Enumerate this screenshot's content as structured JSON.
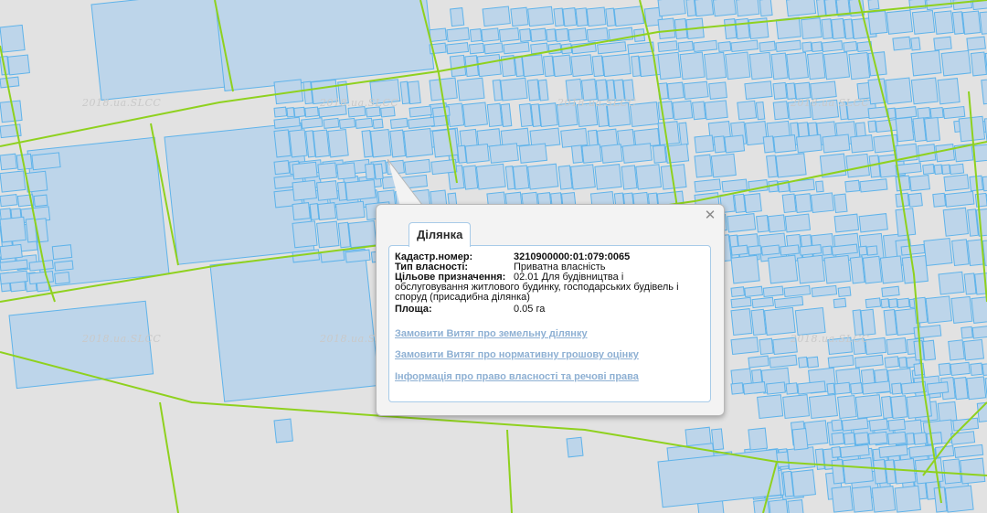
{
  "map": {
    "watermark_text": "2018.ua.SLCC",
    "colors": {
      "background": "#e2e2e2",
      "parcel_fill": "#bdd5ea",
      "parcel_stroke": "#5fb3ea",
      "boundary": "#8fd11e"
    }
  },
  "popup": {
    "tab_label": "Ділянка",
    "close_icon": "close-icon",
    "fields": {
      "cadastre_label": "Кадастр.номер:",
      "cadastre_value": "3210900000:01:079:0065",
      "ownership_label": "Тип власності:",
      "ownership_value": "Приватна власність",
      "purpose_label": "Цільове призначення:",
      "purpose_value_line1": "02.01 Для будівництва і",
      "purpose_value_line2": "обслуговування житлового будинку, господарських будівель і",
      "purpose_value_line3": "споруд (присадибна ділянка)",
      "area_label": "Площа:",
      "area_value": "0.05 га"
    },
    "links": {
      "order_extract": "Замовити Витяг про земельну ділянку",
      "order_valuation": "Замовити Витяг про нормативну грошову оцінку",
      "ownership_info": "Інформація про право власності та речові права"
    }
  }
}
